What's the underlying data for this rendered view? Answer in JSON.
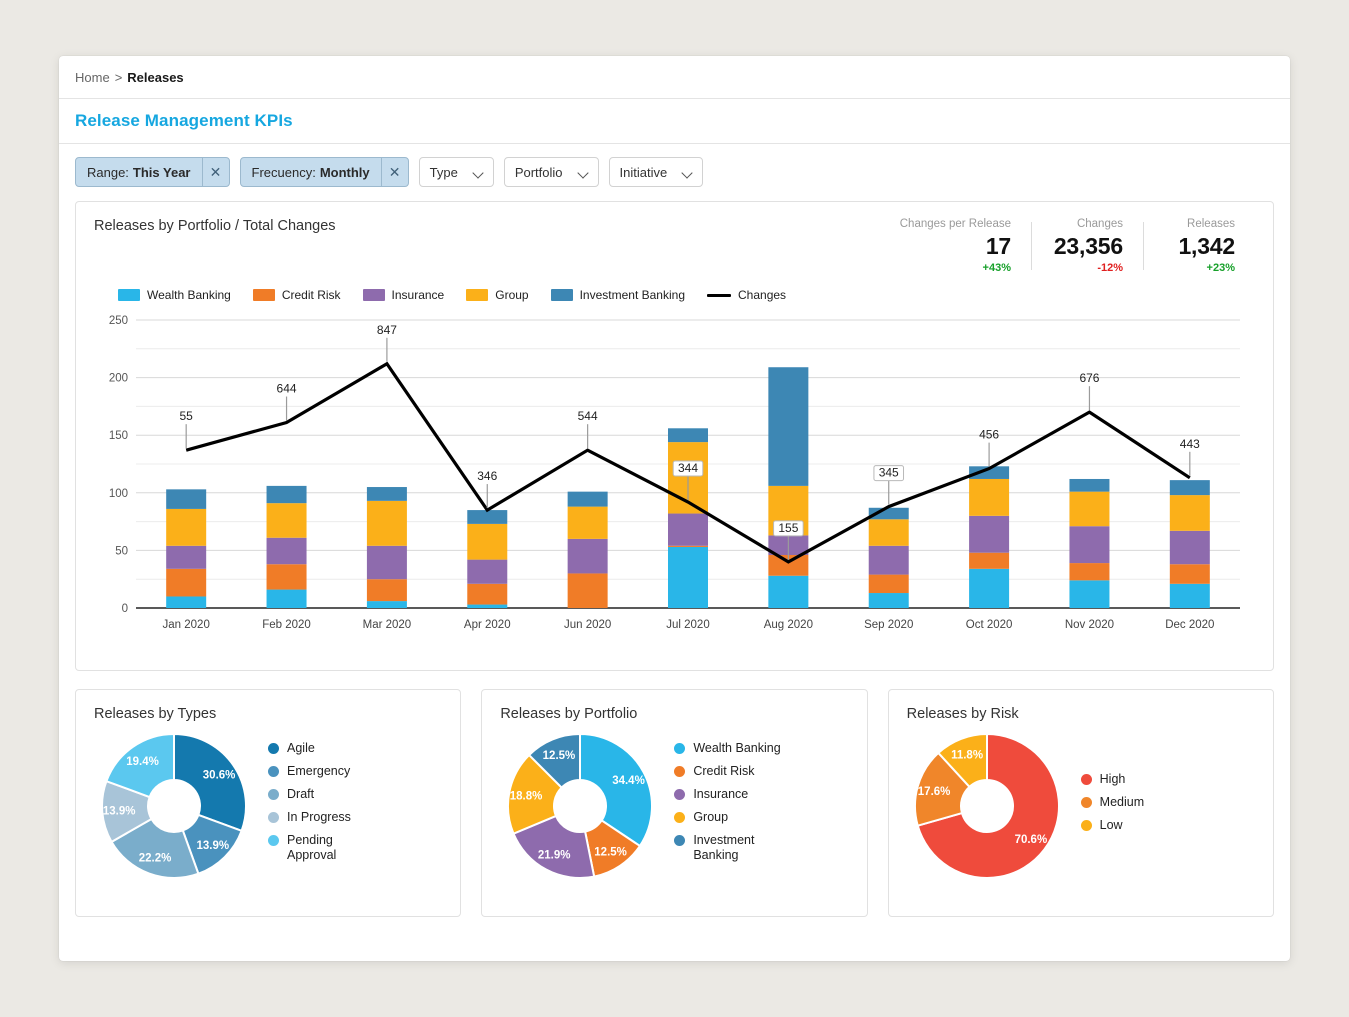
{
  "breadcrumb": {
    "home": "Home",
    "separator": ">",
    "current": "Releases"
  },
  "page_title": "Release Management KPIs",
  "filters": {
    "pills": [
      {
        "label": "Range:",
        "value": "This Year",
        "close": "✕"
      },
      {
        "label": "Frecuency:",
        "value": "Monthly",
        "close": "✕"
      }
    ],
    "selects": [
      {
        "label": "Type"
      },
      {
        "label": "Portfolio"
      },
      {
        "label": "Initiative"
      }
    ]
  },
  "main_panel": {
    "title": "Releases by Portfolio / Total Changes",
    "kpis": [
      {
        "label": "Changes per Release",
        "value": "17",
        "delta": "+43%",
        "dir": "up"
      },
      {
        "label": "Changes",
        "value": "23,356",
        "delta": "-12%",
        "dir": "down"
      },
      {
        "label": "Releases",
        "value": "1,342",
        "delta": "+23%",
        "dir": "up"
      }
    ]
  },
  "colors": {
    "wealth_banking": "#29b6e8",
    "credit_risk": "#f07c27",
    "insurance": "#8e6bad",
    "group": "#fbb019",
    "investment_banking": "#3d87b4",
    "changes_line": "#000000",
    "accent": "#16a7e0",
    "positive": "#17a02a",
    "negative": "#e02020"
  },
  "chart_data": {
    "type": "bar",
    "title": "Releases by Portfolio / Total Changes",
    "xlabel": "",
    "ylabel": "",
    "ylim": [
      0,
      250
    ],
    "yticks": [
      0,
      50,
      100,
      150,
      200,
      250
    ],
    "grid": true,
    "legend_position": "top-left",
    "categories": [
      "Jan 2020",
      "Feb 2020",
      "Mar 2020",
      "Apr 2020",
      "Jun 2020",
      "Jul 2020",
      "Aug 2020",
      "Sep 2020",
      "Oct 2020",
      "Nov 2020",
      "Dec 2020"
    ],
    "series": [
      {
        "name": "Wealth Banking",
        "color": "#29b6e8",
        "values": [
          10,
          16,
          6,
          3,
          0,
          53,
          28,
          13,
          34,
          24,
          21
        ]
      },
      {
        "name": "Credit Risk",
        "color": "#f07c27",
        "values": [
          24,
          22,
          19,
          18,
          30,
          1,
          18,
          16,
          14,
          15,
          17
        ]
      },
      {
        "name": "Insurance",
        "color": "#8e6bad",
        "values": [
          20,
          23,
          29,
          21,
          30,
          28,
          17,
          25,
          32,
          32,
          29
        ]
      },
      {
        "name": "Group",
        "color": "#fbb019",
        "values": [
          32,
          30,
          39,
          31,
          28,
          62,
          43,
          23,
          32,
          30,
          31
        ]
      },
      {
        "name": "Investment Banking",
        "color": "#3d87b4",
        "values": [
          17,
          15,
          12,
          12,
          13,
          12,
          103,
          10,
          11,
          11,
          13
        ]
      }
    ],
    "line_series": {
      "name": "Changes",
      "color": "#000000",
      "labels": [
        "55",
        "644",
        "847",
        "346",
        "544",
        "344",
        "155",
        "345",
        "456",
        "676",
        "443"
      ],
      "plot_values": [
        137,
        161,
        212,
        85,
        137,
        92,
        40,
        88,
        121,
        170,
        113
      ]
    }
  },
  "donuts": [
    {
      "title": "Releases by Types",
      "type": "pie",
      "slices": [
        {
          "label": "Agile",
          "value": 30.6,
          "display": "30.6%",
          "color": "#1479ae"
        },
        {
          "label": "Emergency",
          "value": 13.9,
          "display": "13.9%",
          "color": "#4a92be"
        },
        {
          "label": "Draft",
          "value": 22.2,
          "display": "22.2%",
          "color": "#7aadcb"
        },
        {
          "label": "In Progress",
          "value": 13.9,
          "display": "13.9%",
          "color": "#a8c4d8"
        },
        {
          "label": "Pending Approval",
          "value": 19.4,
          "display": "19.4%",
          "color": "#5bc8ef"
        }
      ]
    },
    {
      "title": "Releases by Portfolio",
      "type": "pie",
      "slices": [
        {
          "label": "Wealth Banking",
          "value": 34.4,
          "display": "34.4%",
          "color": "#29b6e8"
        },
        {
          "label": "Credit Risk",
          "value": 12.5,
          "display": "12.5%",
          "color": "#f07c27"
        },
        {
          "label": "Insurance",
          "value": 21.9,
          "display": "21.9%",
          "color": "#8e6bad"
        },
        {
          "label": "Group",
          "value": 18.8,
          "display": "18.8%",
          "color": "#fbb019"
        },
        {
          "label": "Investment Banking",
          "value": 12.5,
          "display": "12.5%",
          "color": "#3d87b4"
        }
      ]
    },
    {
      "title": "Releases by Risk",
      "type": "pie",
      "slices": [
        {
          "label": "High",
          "value": 70.6,
          "display": "70.6%",
          "color": "#ef4b3c"
        },
        {
          "label": "Medium",
          "value": 17.6,
          "display": "17.6%",
          "color": "#f0862a"
        },
        {
          "label": "Low",
          "value": 11.8,
          "display": "11.8%",
          "color": "#fbb019"
        }
      ]
    }
  ]
}
